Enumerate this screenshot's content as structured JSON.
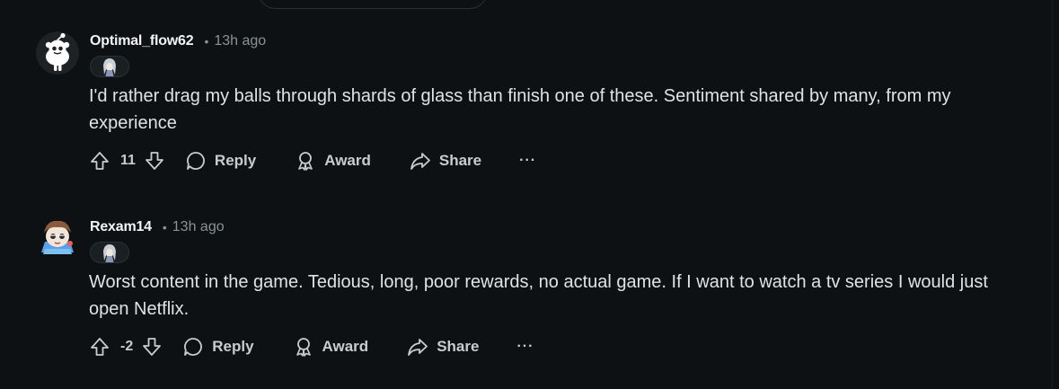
{
  "comments": [
    {
      "username": "Optimal_flow62",
      "separator": "•",
      "time": "13h ago",
      "avatar_icon": "snoo-avatar-icon",
      "flair_icon": "character-flair-icon",
      "body": "I'd rather drag my balls through shards of glass than finish one of these. Sentiment shared by many, from my experience",
      "score": "11",
      "reply_label": "Reply",
      "award_label": "Award",
      "share_label": "Share",
      "more_label": "···"
    },
    {
      "username": "Rexam14",
      "separator": "•",
      "time": "13h ago",
      "avatar_icon": "custom-avatar-icon",
      "flair_icon": "character-flair-icon",
      "body": "Worst content in the game. Tedious, long, poor rewards, no actual game. If I want to watch a tv series I would just open Netflix.",
      "score": "-2",
      "reply_label": "Reply",
      "award_label": "Award",
      "share_label": "Share",
      "more_label": "···"
    }
  ],
  "colors": {
    "background": "#0e1113",
    "text": "#dfe3e6",
    "muted": "#8a9296"
  }
}
